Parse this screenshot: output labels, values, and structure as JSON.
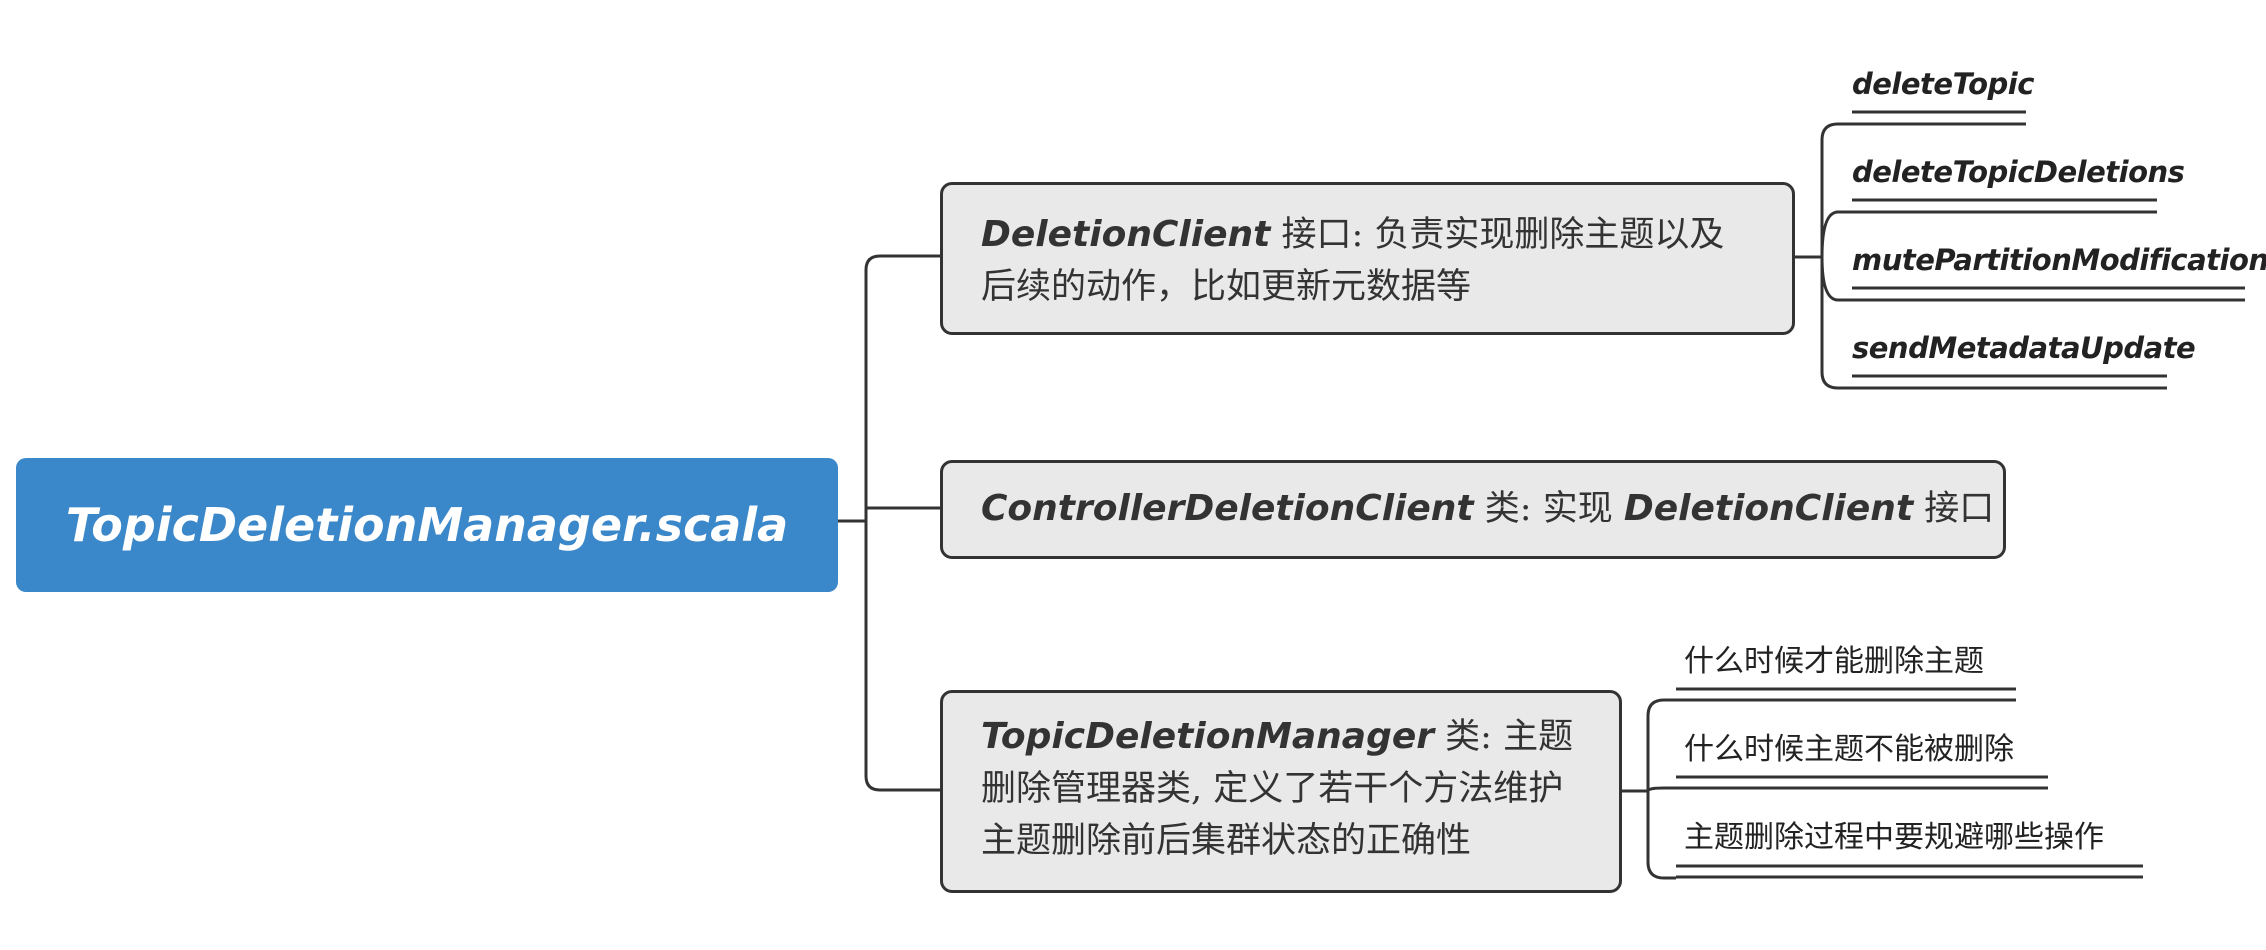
{
  "root": {
    "label": "TopicDeletionManager.scala",
    "color": "#3a87c9"
  },
  "branches": [
    {
      "code": "DeletionClient",
      "text": " 接口: 负责实现删除主题以及后续的动作，比如更新元数据等",
      "children": [
        "deleteTopic",
        "deleteTopicDeletions",
        "mutePartitionModifications",
        "sendMetadataUpdate"
      ]
    },
    {
      "code": "ControllerDeletionClient",
      "text": " 类:  实现 ",
      "code2": "DeletionClient",
      "text2": " 接口",
      "children": []
    },
    {
      "code": "TopicDeletionManager",
      "text": " 类: 主题删除管理器类, 定义了若干个方法维护主题删除前后集群状态的正确性",
      "children": [
        "什么时候才能删除主题",
        "什么时候主题不能被删除",
        "主题删除过程中要规避哪些操作"
      ]
    }
  ],
  "colors": {
    "root_fill": "#3a87c9",
    "node_fill": "#e9e9e9",
    "line": "#333333"
  }
}
